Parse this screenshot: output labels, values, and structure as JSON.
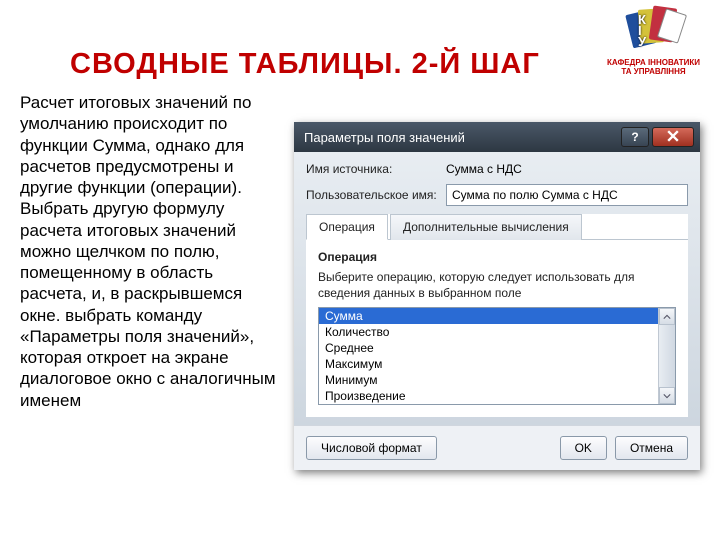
{
  "slide": {
    "title": "СВОДНЫЕ ТАБЛИЦЫ. 2-Й ШАГ",
    "body": "Расчет итоговых значений по умолчанию происходит по функции Сумма, однако для расчетов предусмотрены и другие функции (операции). Выбрать другую формулу расчета итоговых значений можно щелчком по полю, помещенному в область расчета, и, в раскрывшемся окне. выбрать команду «Параметры поля значений», которая откроет на экране диалоговое окно с аналогичным именем"
  },
  "logo": {
    "letters": "К\nІ\nУ",
    "caption1": "КАФЕДРА ІННОВАТИКИ",
    "caption2": "ТА УПРАВЛІННЯ"
  },
  "dialog": {
    "title": "Параметры поля значений",
    "help": "?",
    "source_label": "Имя источника:",
    "source_value": "Сумма с НДС",
    "custom_label": "Пользовательское имя:",
    "custom_value": "Сумма по полю Сумма с НДС",
    "tabs": {
      "op": "Операция",
      "extra": "Дополнительные вычисления"
    },
    "panel": {
      "heading": "Операция",
      "caption": "Выберите операцию, которую следует использовать для сведения данных в выбранном поле",
      "items": [
        "Сумма",
        "Количество",
        "Среднее",
        "Максимум",
        "Минимум",
        "Произведение"
      ]
    },
    "buttons": {
      "numformat": "Числовой формат",
      "ok": "OK",
      "cancel": "Отмена"
    }
  }
}
